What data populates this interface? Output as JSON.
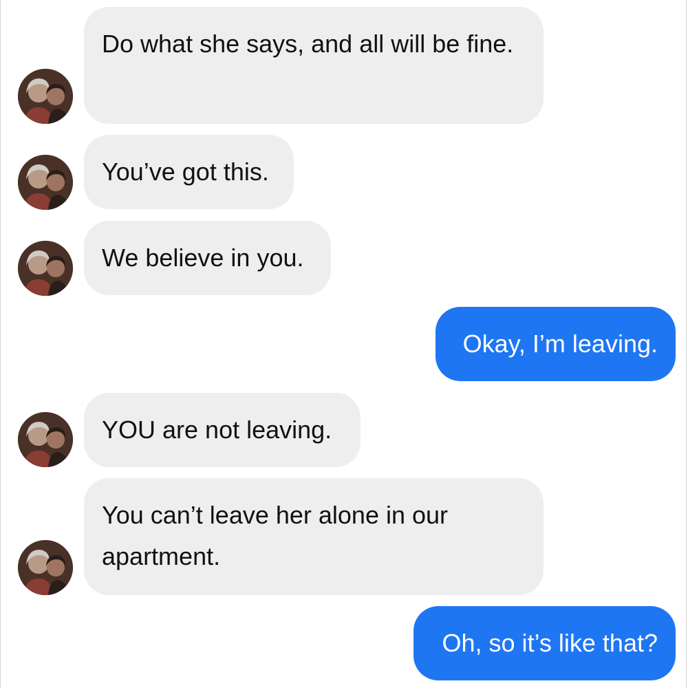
{
  "conversation": {
    "messages": [
      {
        "sender": "them",
        "text": "Do what she says, and all will be fine."
      },
      {
        "sender": "them",
        "text": "You’ve got this."
      },
      {
        "sender": "them",
        "text": "We believe in you."
      },
      {
        "sender": "me",
        "text": "Okay, I’m leaving."
      },
      {
        "sender": "them",
        "text": "YOU are not leaving."
      },
      {
        "sender": "them",
        "text": "You can’t leave her alone in our apartment."
      },
      {
        "sender": "me",
        "text": "Oh, so it’s like that?"
      }
    ]
  },
  "colors": {
    "incoming_bubble": "#eeeeee",
    "outgoing_bubble": "#1f76f2",
    "outgoing_text": "#ffffff"
  },
  "icons": {
    "avatar": "contact-photo-avatar"
  }
}
